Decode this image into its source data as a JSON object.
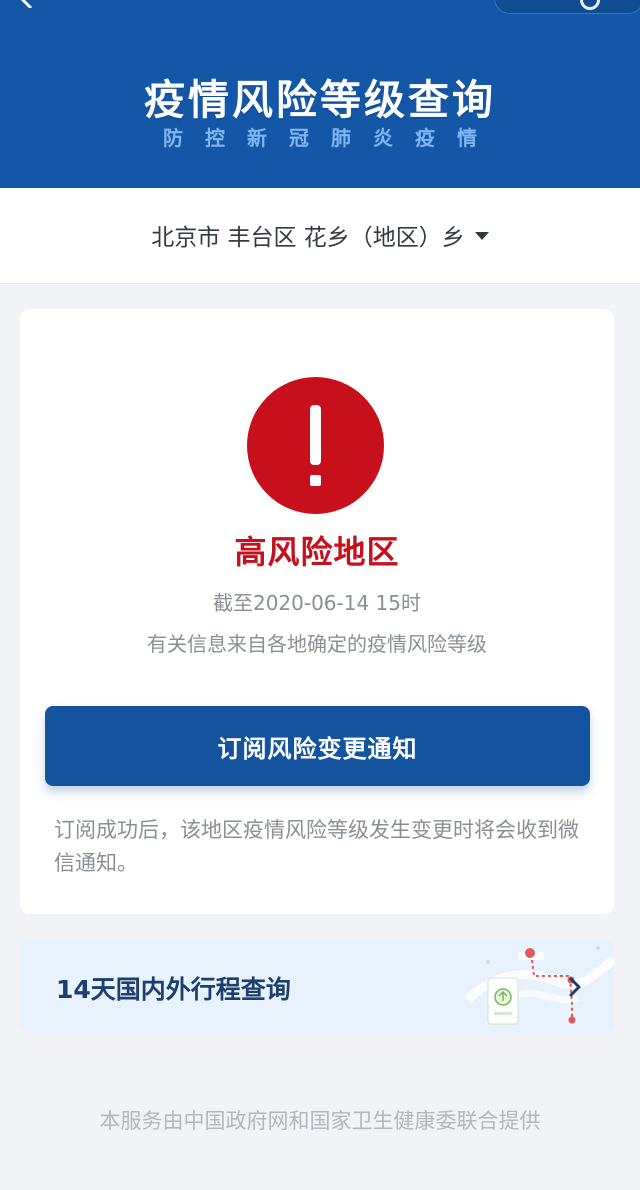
{
  "header": {
    "title": "疫情风险等级查询",
    "subtitle": "防控新冠肺炎疫情"
  },
  "region": {
    "text": "北京市 丰台区 花乡（地区）乡"
  },
  "risk": {
    "level": "高风险地区",
    "as_of": "截至2020-06-14 15时",
    "source": "有关信息来自各地确定的疫情风险等级",
    "color": "#c8101d"
  },
  "subscribe": {
    "button_label": "订阅风险变更通知",
    "note": "订阅成功后，该地区疫情风险等级发生变更时将会收到微信通知。"
  },
  "trip": {
    "label": "14天国内外行程查询"
  },
  "footer": {
    "text": "本服务由中国政府网和国家卫生健康委联合提供"
  },
  "icons": [
    "back-icon",
    "alert-icon",
    "dropdown-caret-icon",
    "map-route-icon",
    "chevron-right-icon"
  ],
  "colors": {
    "brand_blue": "#1457a6",
    "alert_red": "#c8101d",
    "page_bg": "#f1f3f6"
  }
}
